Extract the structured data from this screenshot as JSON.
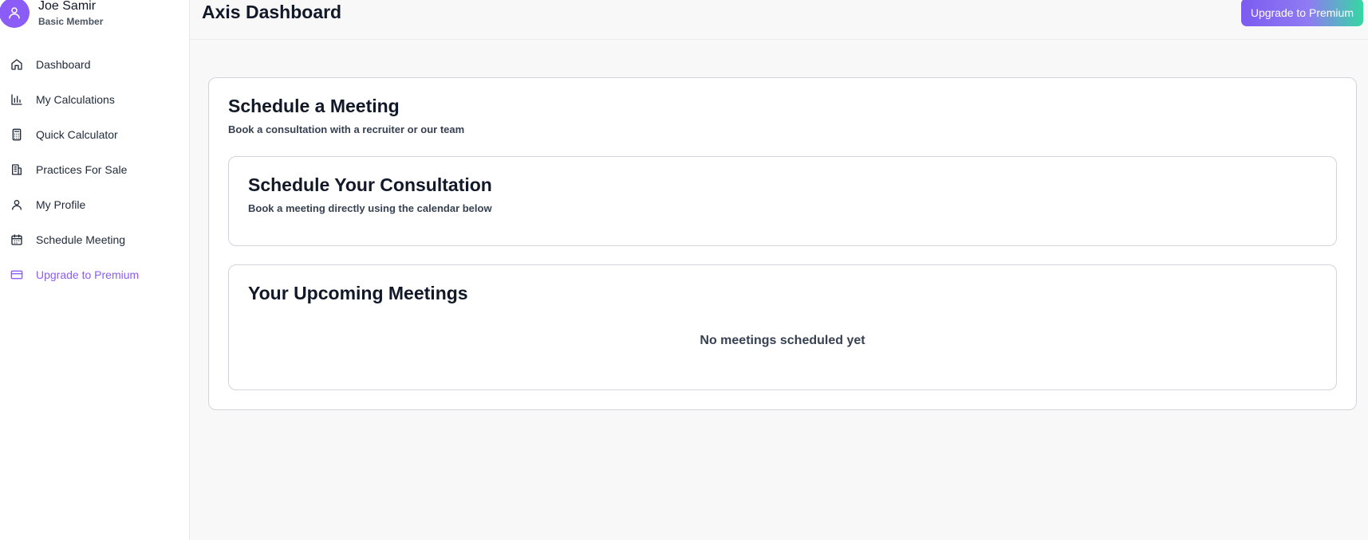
{
  "user": {
    "name": "Joe Samir",
    "tier": "Basic Member"
  },
  "sidebar": {
    "items": [
      {
        "label": "Dashboard",
        "icon": "home-icon"
      },
      {
        "label": "My Calculations",
        "icon": "bar-chart-icon"
      },
      {
        "label": "Quick Calculator",
        "icon": "calculator-icon"
      },
      {
        "label": "Practices For Sale",
        "icon": "building-icon"
      },
      {
        "label": "My Profile",
        "icon": "user-icon"
      },
      {
        "label": "Schedule Meeting",
        "icon": "calendar-icon"
      },
      {
        "label": "Upgrade to Premium",
        "icon": "credit-card-icon"
      }
    ]
  },
  "header": {
    "title": "Axis Dashboard",
    "upgrade_label": "Upgrade to Premium"
  },
  "schedule": {
    "title": "Schedule a Meeting",
    "subtitle": "Book a consultation with a recruiter or our team",
    "consultation": {
      "title": "Schedule Your Consultation",
      "subtitle": "Book a meeting directly using the calendar below"
    },
    "upcoming": {
      "title": "Your Upcoming Meetings",
      "empty": "No meetings scheduled yet"
    }
  },
  "colors": {
    "accent": "#8b5cf6",
    "gradient_end": "#34d8a2"
  }
}
